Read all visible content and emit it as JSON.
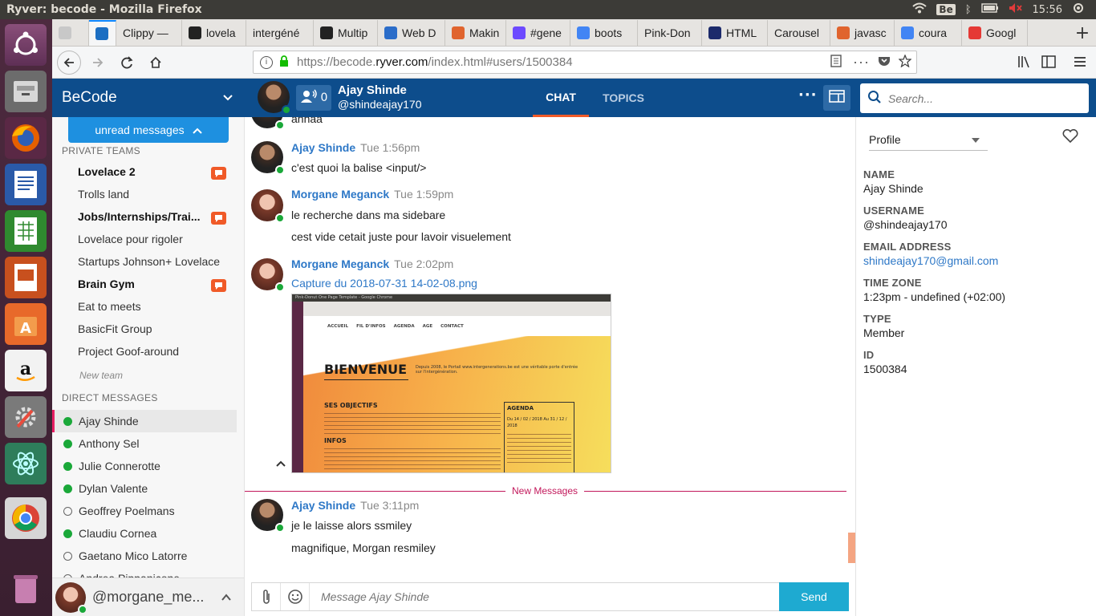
{
  "os": {
    "window_title": "Ryver: becode - Mozilla Firefox",
    "keyboard_layout": "Be",
    "clock": "15:56"
  },
  "tabs": [
    {
      "label": "",
      "color": "#c8c8c8"
    },
    {
      "label": "",
      "color": "#1b6ec2",
      "active": true
    },
    {
      "label": "Clippy —",
      "color": ""
    },
    {
      "label": "lovela",
      "color": "#222"
    },
    {
      "label": "intergéné",
      "color": ""
    },
    {
      "label": "Multip",
      "color": "#222"
    },
    {
      "label": "Web D",
      "color": "#2b6dc9"
    },
    {
      "label": "Makin",
      "color": "#e0642e"
    },
    {
      "label": "#gene",
      "color": "#6d4aff"
    },
    {
      "label": "boots",
      "color": "#4285f4"
    },
    {
      "label": "Pink-Don",
      "color": ""
    },
    {
      "label": "HTML",
      "color": "#1c2a6b"
    },
    {
      "label": "Carousel",
      "color": ""
    },
    {
      "label": "javasc",
      "color": "#e0642e"
    },
    {
      "label": "coura",
      "color": "#4285f4"
    },
    {
      "label": "Googl",
      "color": "#e53935"
    }
  ],
  "url": {
    "prefix": "https://becode.",
    "domain": "ryver.com",
    "path": "/index.html#users/1500384"
  },
  "app": {
    "org_name": "BeCode",
    "chat_user": "Ajay Shinde",
    "chat_handle": "@shindeajay170",
    "participants": "0",
    "tab_chat": "CHAT",
    "tab_topics": "TOPICS",
    "search_placeholder": "Search..."
  },
  "sidebar": {
    "unread_button": "unread messages",
    "private_teams_header": "PRIVATE TEAMS",
    "teams": [
      {
        "name": "Lovelace 2",
        "bold": true,
        "badge": true
      },
      {
        "name": "Trolls land",
        "bold": false,
        "badge": false
      },
      {
        "name": "Jobs/Internships/Trai...",
        "bold": true,
        "badge": true
      },
      {
        "name": "Lovelace pour rigoler",
        "bold": false,
        "badge": false
      },
      {
        "name": "Startups Johnson+ Lovelace",
        "bold": false,
        "badge": false
      },
      {
        "name": "Brain Gym",
        "bold": true,
        "badge": true
      },
      {
        "name": "Eat to meets",
        "bold": false,
        "badge": false
      },
      {
        "name": "BasicFit Group",
        "bold": false,
        "badge": false
      },
      {
        "name": "Project Goof-around",
        "bold": false,
        "badge": false
      }
    ],
    "new_team": "New team",
    "direct_messages_header": "DIRECT MESSAGES",
    "direct_messages": [
      {
        "name": "Ajay Shinde",
        "online": true,
        "selected": true
      },
      {
        "name": "Anthony Sel",
        "online": true
      },
      {
        "name": "Julie Connerotte",
        "online": true
      },
      {
        "name": "Dylan Valente",
        "online": true
      },
      {
        "name": "Geoffrey Poelmans",
        "online": false
      },
      {
        "name": "Claudiu Cornea",
        "online": true
      },
      {
        "name": "Gaetano Mico Latorre",
        "online": false
      },
      {
        "name": "Andrea Pippanicone",
        "online": false
      }
    ],
    "current_user": "@morgane_me..."
  },
  "messages": {
    "partial_top": "ahhaa",
    "list": [
      {
        "author": "Ajay Shinde",
        "time": "Tue 1:56pm",
        "lines": [
          "c'est quoi la balise <input/>"
        ],
        "avatar": "ajay"
      },
      {
        "author": "Morgane Meganck",
        "time": "Tue 1:59pm",
        "lines": [
          "le recherche dans ma sidebare",
          "cest vide cetait juste pour lavoir visuelement"
        ],
        "avatar": "morgane"
      },
      {
        "author": "Morgane Meganck",
        "time": "Tue 2:02pm",
        "lines": [],
        "attachment": "Capture du 2018-07-31 14-02-08.png",
        "avatar": "morgane"
      }
    ],
    "new_divider": "New Messages",
    "after_divider": {
      "author": "Ajay Shinde",
      "time": "Tue 3:11pm",
      "lines": [
        "je le laisse alors ssmiley",
        "magnifique, Morgan resmiley"
      ]
    }
  },
  "screenshot_thumb": {
    "title_bar": "Pink-Donut One Page Template - Google Chrome",
    "nav": [
      "ACCUEIL",
      "FIL D'INFOS",
      "AGENDA",
      "AGE",
      "CONTACT"
    ],
    "hero": "BIENVENUE",
    "hero_text": "Depuis 2008, le Portail www.intergenerations.be est une véritable porte d'entrée sur l'intergénération.",
    "objectives": "SES OBJECTIFS",
    "infos": "INFOS",
    "agenda_title": "AGENDA",
    "agenda_dates": "Du 14 / 02 / 2018 Au 31 / 12 / 2018"
  },
  "composer": {
    "placeholder": "Message Ajay Shinde",
    "send": "Send"
  },
  "profile": {
    "dropdown": "Profile",
    "fields": [
      {
        "label": "NAME",
        "value": "Ajay Shinde"
      },
      {
        "label": "USERNAME",
        "value": "@shindeajay170"
      },
      {
        "label": "EMAIL ADDRESS",
        "value": "shindeajay170@gmail.com",
        "link": true
      },
      {
        "label": "TIME ZONE",
        "value": "1:23pm - undefined (+02:00)"
      },
      {
        "label": "TYPE",
        "value": "Member"
      },
      {
        "label": "ID",
        "value": "1500384"
      }
    ]
  },
  "colors": {
    "header_blue": "#0d4d8c",
    "link_blue": "#2e78c7",
    "accent_orange": "#f05a28",
    "online_green": "#1aa839",
    "send_teal": "#1eaad1",
    "new_messages_pink": "#c2185b"
  }
}
